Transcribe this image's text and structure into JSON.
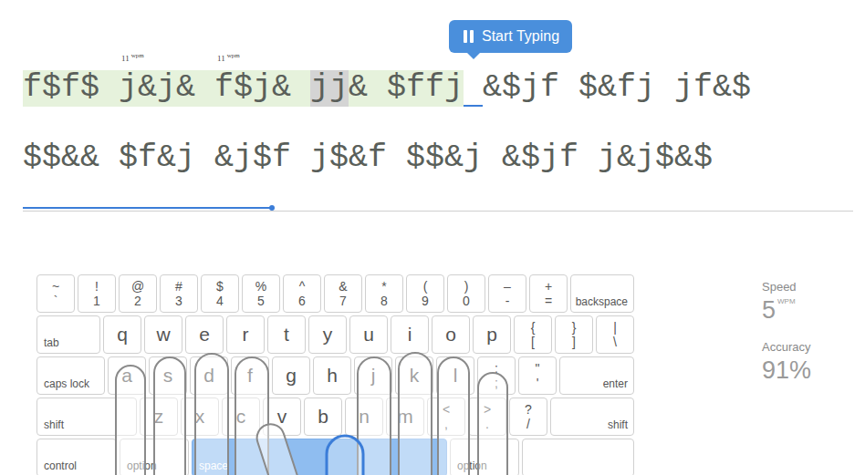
{
  "typing": {
    "lines": [
      {
        "words": [
          {
            "text": "f$f$",
            "marks": [
              "ok",
              "ok",
              "ok",
              "ok"
            ],
            "trailing": "ok"
          },
          {
            "text": "j&j&",
            "marks": [
              "ok",
              "ok",
              "ok",
              "ok"
            ],
            "trailing": "ok",
            "wpm": {
              "value": "11",
              "unit": "wpm"
            }
          },
          {
            "text": "f$j&",
            "marks": [
              "ok",
              "ok",
              "ok",
              "ok"
            ],
            "trailing": "ok",
            "wpm": {
              "value": "11",
              "unit": "wpm"
            }
          },
          {
            "text": "jj&",
            "marks": [
              "miss",
              "miss",
              "ok"
            ],
            "trailing": "ok"
          },
          {
            "text": "$ffj",
            "marks": [
              "ok",
              "ok",
              "ok",
              "ok"
            ],
            "trailing": "cursor"
          },
          {
            "text": "&$jf",
            "marks": [
              "none",
              "none",
              "none",
              "none"
            ],
            "trailing": "none"
          },
          {
            "text": "$&fj",
            "marks": [
              "none",
              "none",
              "none",
              "none"
            ],
            "trailing": "none"
          },
          {
            "text": "jf&$",
            "marks": [
              "none",
              "none",
              "none",
              "none"
            ],
            "trailing": "none"
          }
        ]
      },
      {
        "words": [
          {
            "text": "$$&&",
            "marks": [
              "none",
              "none",
              "none",
              "none"
            ],
            "trailing": "none"
          },
          {
            "text": "$f&j",
            "marks": [
              "none",
              "none",
              "none",
              "none"
            ],
            "trailing": "none"
          },
          {
            "text": "&j$f",
            "marks": [
              "none",
              "none",
              "none",
              "none"
            ],
            "trailing": "none"
          },
          {
            "text": "j$&f",
            "marks": [
              "none",
              "none",
              "none",
              "none"
            ],
            "trailing": "none"
          },
          {
            "text": "$$&j",
            "marks": [
              "none",
              "none",
              "none",
              "none"
            ],
            "trailing": "none"
          },
          {
            "text": "&$jf",
            "marks": [
              "none",
              "none",
              "none",
              "none"
            ],
            "trailing": "none"
          },
          {
            "text": "j&j$&$",
            "marks": [
              "none",
              "none",
              "none",
              "none",
              "none",
              "none"
            ],
            "trailing": "none"
          }
        ]
      }
    ],
    "tooltip": {
      "label": "Start Typing"
    },
    "progress": {
      "level": 0.3
    }
  },
  "keyboard": {
    "rows": [
      [
        {
          "kind": "dual",
          "top": "~",
          "bottom": "`",
          "highlighted": false
        },
        {
          "kind": "dual",
          "top": "!",
          "bottom": "1",
          "highlighted": false
        },
        {
          "kind": "dual",
          "top": "@",
          "bottom": "2",
          "highlighted": false
        },
        {
          "kind": "dual",
          "top": "#",
          "bottom": "3",
          "highlighted": false
        },
        {
          "kind": "dual",
          "top": "$",
          "bottom": "4",
          "highlighted": false
        },
        {
          "kind": "dual",
          "top": "%",
          "bottom": "5",
          "highlighted": false
        },
        {
          "kind": "dual",
          "top": "^",
          "bottom": "6",
          "highlighted": false
        },
        {
          "kind": "dual",
          "top": "&",
          "bottom": "7",
          "highlighted": false
        },
        {
          "kind": "dual",
          "top": "*",
          "bottom": "8",
          "highlighted": false
        },
        {
          "kind": "dual",
          "top": "(",
          "bottom": "9",
          "highlighted": false
        },
        {
          "kind": "dual",
          "top": ")",
          "bottom": "0",
          "highlighted": false
        },
        {
          "kind": "dual",
          "top": "–",
          "bottom": "-",
          "highlighted": false
        },
        {
          "kind": "dual",
          "top": "+",
          "bottom": "=",
          "highlighted": false
        },
        {
          "kind": "backspace",
          "label": "backspace",
          "highlighted": false
        }
      ],
      [
        {
          "kind": "tab",
          "label": "tab",
          "highlighted": false
        },
        {
          "kind": "char",
          "label": "q",
          "highlighted": false
        },
        {
          "kind": "char",
          "label": "w",
          "highlighted": false
        },
        {
          "kind": "char",
          "label": "e",
          "highlighted": false
        },
        {
          "kind": "char",
          "label": "r",
          "highlighted": false
        },
        {
          "kind": "char",
          "label": "t",
          "highlighted": false
        },
        {
          "kind": "char",
          "label": "y",
          "highlighted": false
        },
        {
          "kind": "char",
          "label": "u",
          "highlighted": false
        },
        {
          "kind": "char",
          "label": "i",
          "highlighted": false
        },
        {
          "kind": "char",
          "label": "o",
          "highlighted": false
        },
        {
          "kind": "char",
          "label": "p",
          "highlighted": false
        },
        {
          "kind": "dual",
          "top": "{",
          "bottom": "[",
          "highlighted": false
        },
        {
          "kind": "dual",
          "top": "}",
          "bottom": "]",
          "highlighted": false
        },
        {
          "kind": "dual",
          "top": "|",
          "bottom": "\\",
          "highlighted": false
        }
      ],
      [
        {
          "kind": "caps",
          "label": "caps lock",
          "highlighted": false
        },
        {
          "kind": "char",
          "label": "a",
          "highlighted": false
        },
        {
          "kind": "char",
          "label": "s",
          "highlighted": false
        },
        {
          "kind": "char",
          "label": "d",
          "highlighted": false
        },
        {
          "kind": "char",
          "label": "f",
          "highlighted": false
        },
        {
          "kind": "char",
          "label": "g",
          "highlighted": false
        },
        {
          "kind": "char",
          "label": "h",
          "highlighted": false
        },
        {
          "kind": "char",
          "label": "j",
          "highlighted": false
        },
        {
          "kind": "char",
          "label": "k",
          "highlighted": false
        },
        {
          "kind": "char",
          "label": "l",
          "highlighted": false
        },
        {
          "kind": "dual",
          "top": ":",
          "bottom": ";",
          "highlighted": false
        },
        {
          "kind": "dual",
          "top": "\"",
          "bottom": "'",
          "highlighted": false
        },
        {
          "kind": "enter",
          "label": "enter",
          "highlighted": false
        }
      ],
      [
        {
          "kind": "lshift",
          "label": "shift",
          "highlighted": false
        },
        {
          "kind": "char",
          "label": "z",
          "highlighted": false
        },
        {
          "kind": "char",
          "label": "x",
          "highlighted": false
        },
        {
          "kind": "char",
          "label": "c",
          "highlighted": false
        },
        {
          "kind": "char",
          "label": "v",
          "highlighted": false
        },
        {
          "kind": "char",
          "label": "b",
          "highlighted": false
        },
        {
          "kind": "char",
          "label": "n",
          "highlighted": false
        },
        {
          "kind": "char",
          "label": "m",
          "highlighted": false
        },
        {
          "kind": "dual",
          "top": "<",
          "bottom": ",",
          "highlighted": false
        },
        {
          "kind": "dual",
          "top": ">",
          "bottom": ".",
          "highlighted": false
        },
        {
          "kind": "dual",
          "top": "?",
          "bottom": "/",
          "highlighted": false
        },
        {
          "kind": "rshift",
          "label": "shift",
          "highlighted": false
        }
      ],
      [
        {
          "kind": "control",
          "label": "control",
          "highlighted": false
        },
        {
          "kind": "option",
          "label": "option",
          "highlighted": false
        },
        {
          "kind": "space",
          "label": "space",
          "highlighted": true
        },
        {
          "kind": "option",
          "label": "option",
          "highlighted": false
        },
        {
          "kind": "blank",
          "label": "",
          "highlighted": false
        }
      ]
    ]
  },
  "stats": [
    {
      "label": "Speed",
      "value": "5",
      "unit": "WPM"
    },
    {
      "label": "Accuracy",
      "value": "91%"
    }
  ]
}
